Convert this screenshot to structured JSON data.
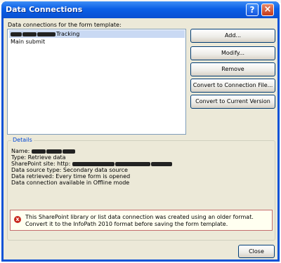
{
  "window": {
    "title": "Data Connections",
    "help_glyph": "?",
    "close_glyph": "×"
  },
  "connections_label": "Data connections for the form template:",
  "connections": [
    {
      "label": "Tracking",
      "redacted": true,
      "selected": true
    },
    {
      "label": "Main submit",
      "redacted": false,
      "selected": false
    }
  ],
  "buttons": {
    "add": "Add...",
    "modify": "Modify...",
    "remove": "Remove",
    "convert_file": "Convert to Connection File...",
    "convert_version": "Convert to Current Version",
    "close": "Close"
  },
  "details": {
    "legend": "Details",
    "name_label": "Name:",
    "type": "Type: Retrieve data",
    "site_label": "SharePoint site: http:",
    "source_type": "Data source type: Secondary data source",
    "retrieved": "Data retrieved: Every time form is opened",
    "offline": "Data connection available in Offline mode"
  },
  "warning": {
    "icon": "error-icon",
    "icon_glyph": "x",
    "text": "This SharePoint library or list data connection was created using an older format. Convert it to the InfoPath 2010 format before saving the form template."
  },
  "colors": {
    "titlebar": "#0a52d6",
    "dialog_bg": "#ece9d8",
    "selection": "#c9d9f3",
    "warning_border": "#c46d6d",
    "error_icon": "#c8261c"
  }
}
